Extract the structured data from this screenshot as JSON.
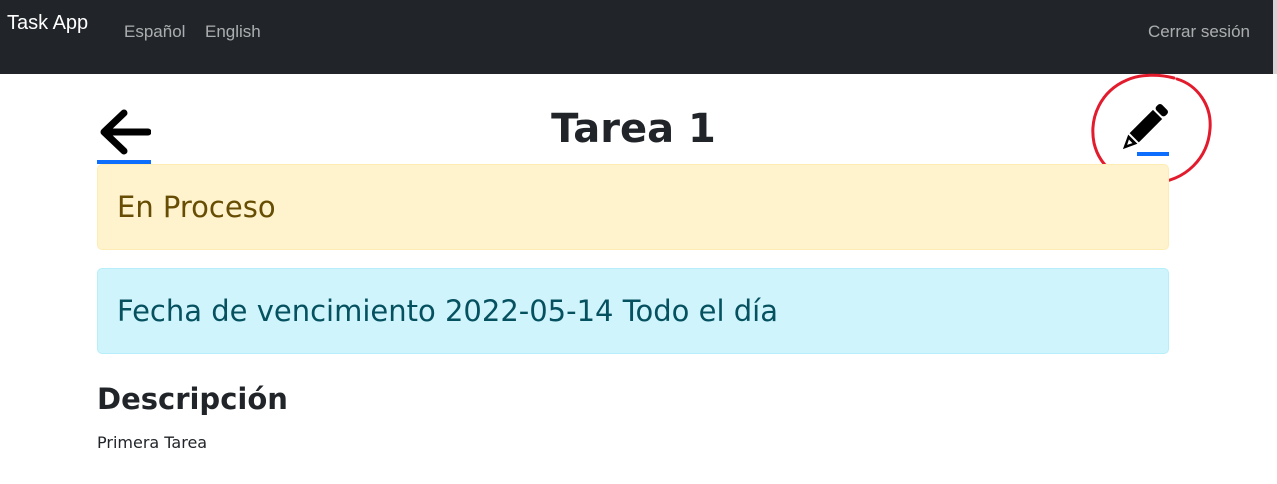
{
  "navbar": {
    "brand": "Task App",
    "links": [
      "Español",
      "English"
    ],
    "logout": "Cerrar sesión"
  },
  "page": {
    "title": "Tarea 1",
    "back_icon": "arrow-left-icon",
    "edit_icon": "pencil-icon"
  },
  "task": {
    "status": "En Proceso",
    "due": "Fecha de vencimiento 2022-05-14 Todo el día",
    "description_heading": "Descripción",
    "description": "Primera Tarea"
  },
  "colors": {
    "navbar_bg": "#212529",
    "link_underline": "#0d6efd",
    "status_bg": "#fff3cd",
    "status_text": "#664d03",
    "due_bg": "#cff4fc",
    "due_text": "#055160",
    "annotation": "#e21b2d"
  }
}
